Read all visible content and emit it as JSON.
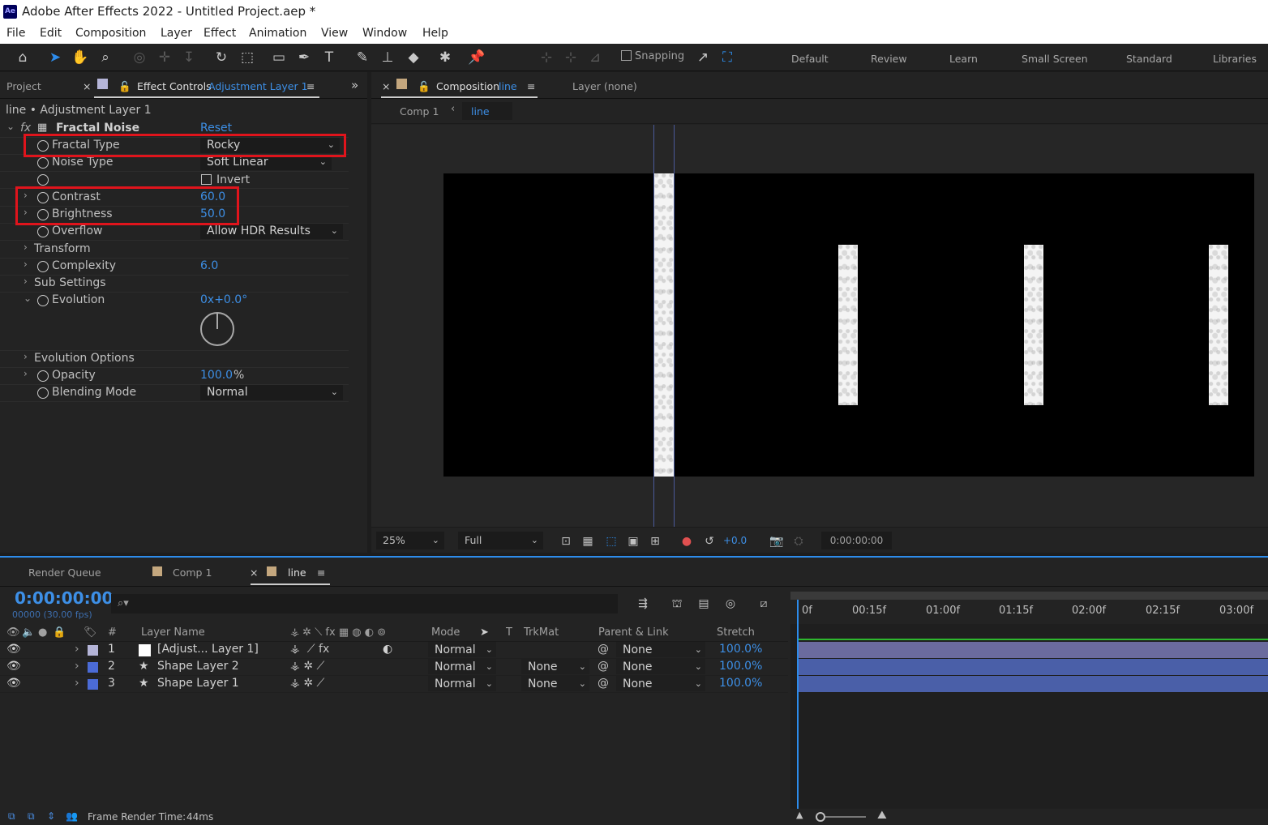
{
  "window": {
    "title": "Adobe After Effects 2022 - Untitled Project.aep *",
    "app_icon": "Ae"
  },
  "menu": [
    "File",
    "Edit",
    "Composition",
    "Layer",
    "Effect",
    "Animation",
    "View",
    "Window",
    "Help"
  ],
  "toolbar": {
    "snapping_label": "Snapping",
    "workspaces": [
      "Default",
      "Review",
      "Learn",
      "Small Screen",
      "Standard",
      "Libraries"
    ]
  },
  "left_panel": {
    "tab_project": "Project",
    "tab_effect_controls": "Effect Controls",
    "tab_effect_controls_target": "Adjustment Layer 1",
    "breadcrumb": "line • Adjustment Layer 1",
    "effect_name": "Fractal Noise",
    "effect_fx": "fx",
    "reset_label": "Reset",
    "props": {
      "fractal_type": {
        "name": "Fractal Type",
        "value": "Rocky"
      },
      "noise_type": {
        "name": "Noise Type",
        "value": "Soft Linear"
      },
      "invert": {
        "name": "Invert"
      },
      "contrast": {
        "name": "Contrast",
        "value": "60.0"
      },
      "brightness": {
        "name": "Brightness",
        "value": "50.0"
      },
      "overflow": {
        "name": "Overflow",
        "value": "Allow HDR Results"
      },
      "transform": {
        "name": "Transform"
      },
      "complexity": {
        "name": "Complexity",
        "value": "6.0"
      },
      "sub_settings": {
        "name": "Sub Settings"
      },
      "evolution": {
        "name": "Evolution",
        "value": "0x+0.0°"
      },
      "evolution_options": {
        "name": "Evolution Options"
      },
      "opacity": {
        "name": "Opacity",
        "value": "100.0",
        "unit": "%"
      },
      "blending_mode": {
        "name": "Blending Mode",
        "value": "Normal"
      }
    }
  },
  "viewer": {
    "tab_composition": "Composition",
    "tab_composition_name": "line",
    "tab_layer": "Layer (none)",
    "subtabs": [
      "Comp 1",
      "line"
    ],
    "zoom": "25%",
    "resolution": "Full",
    "exposure": "+0.0",
    "timecode": "0:00:00:00"
  },
  "timeline": {
    "tabs": [
      "Render Queue",
      "Comp 1",
      "line"
    ],
    "timecode": "0:00:00:00",
    "timecode_sub": "00000 (30.00 fps)",
    "search_placeholder": "",
    "columns": {
      "num": "#",
      "layer_name": "Layer Name",
      "mode": "Mode",
      "t": "T",
      "trkmat": "TrkMat",
      "parent": "Parent & Link",
      "stretch": "Stretch"
    },
    "layers": [
      {
        "num": "1",
        "name": "[Adjust... Layer 1]",
        "mode": "Normal",
        "trkmat": "",
        "parent": "None",
        "stretch": "100.0%",
        "label_color": "#b5b5d8"
      },
      {
        "num": "2",
        "name": "Shape Layer 2",
        "mode": "Normal",
        "trkmat": "None",
        "parent": "None",
        "stretch": "100.0%",
        "label_color": "#4b6bd6"
      },
      {
        "num": "3",
        "name": "Shape Layer 1",
        "mode": "Normal",
        "trkmat": "None",
        "parent": "None",
        "stretch": "100.0%",
        "label_color": "#4b6bd6"
      }
    ],
    "ruler_ticks": [
      "0f",
      "00:15f",
      "01:00f",
      "01:15f",
      "02:00f",
      "02:15f",
      "03:00f"
    ],
    "footer": {
      "label": "Frame Render Time:",
      "value": "44ms"
    }
  },
  "colors": {
    "accent": "#2d8ceb",
    "value_blue": "#3d8fe6",
    "highlight": "#e0141c",
    "track": "#5b5b9a"
  }
}
